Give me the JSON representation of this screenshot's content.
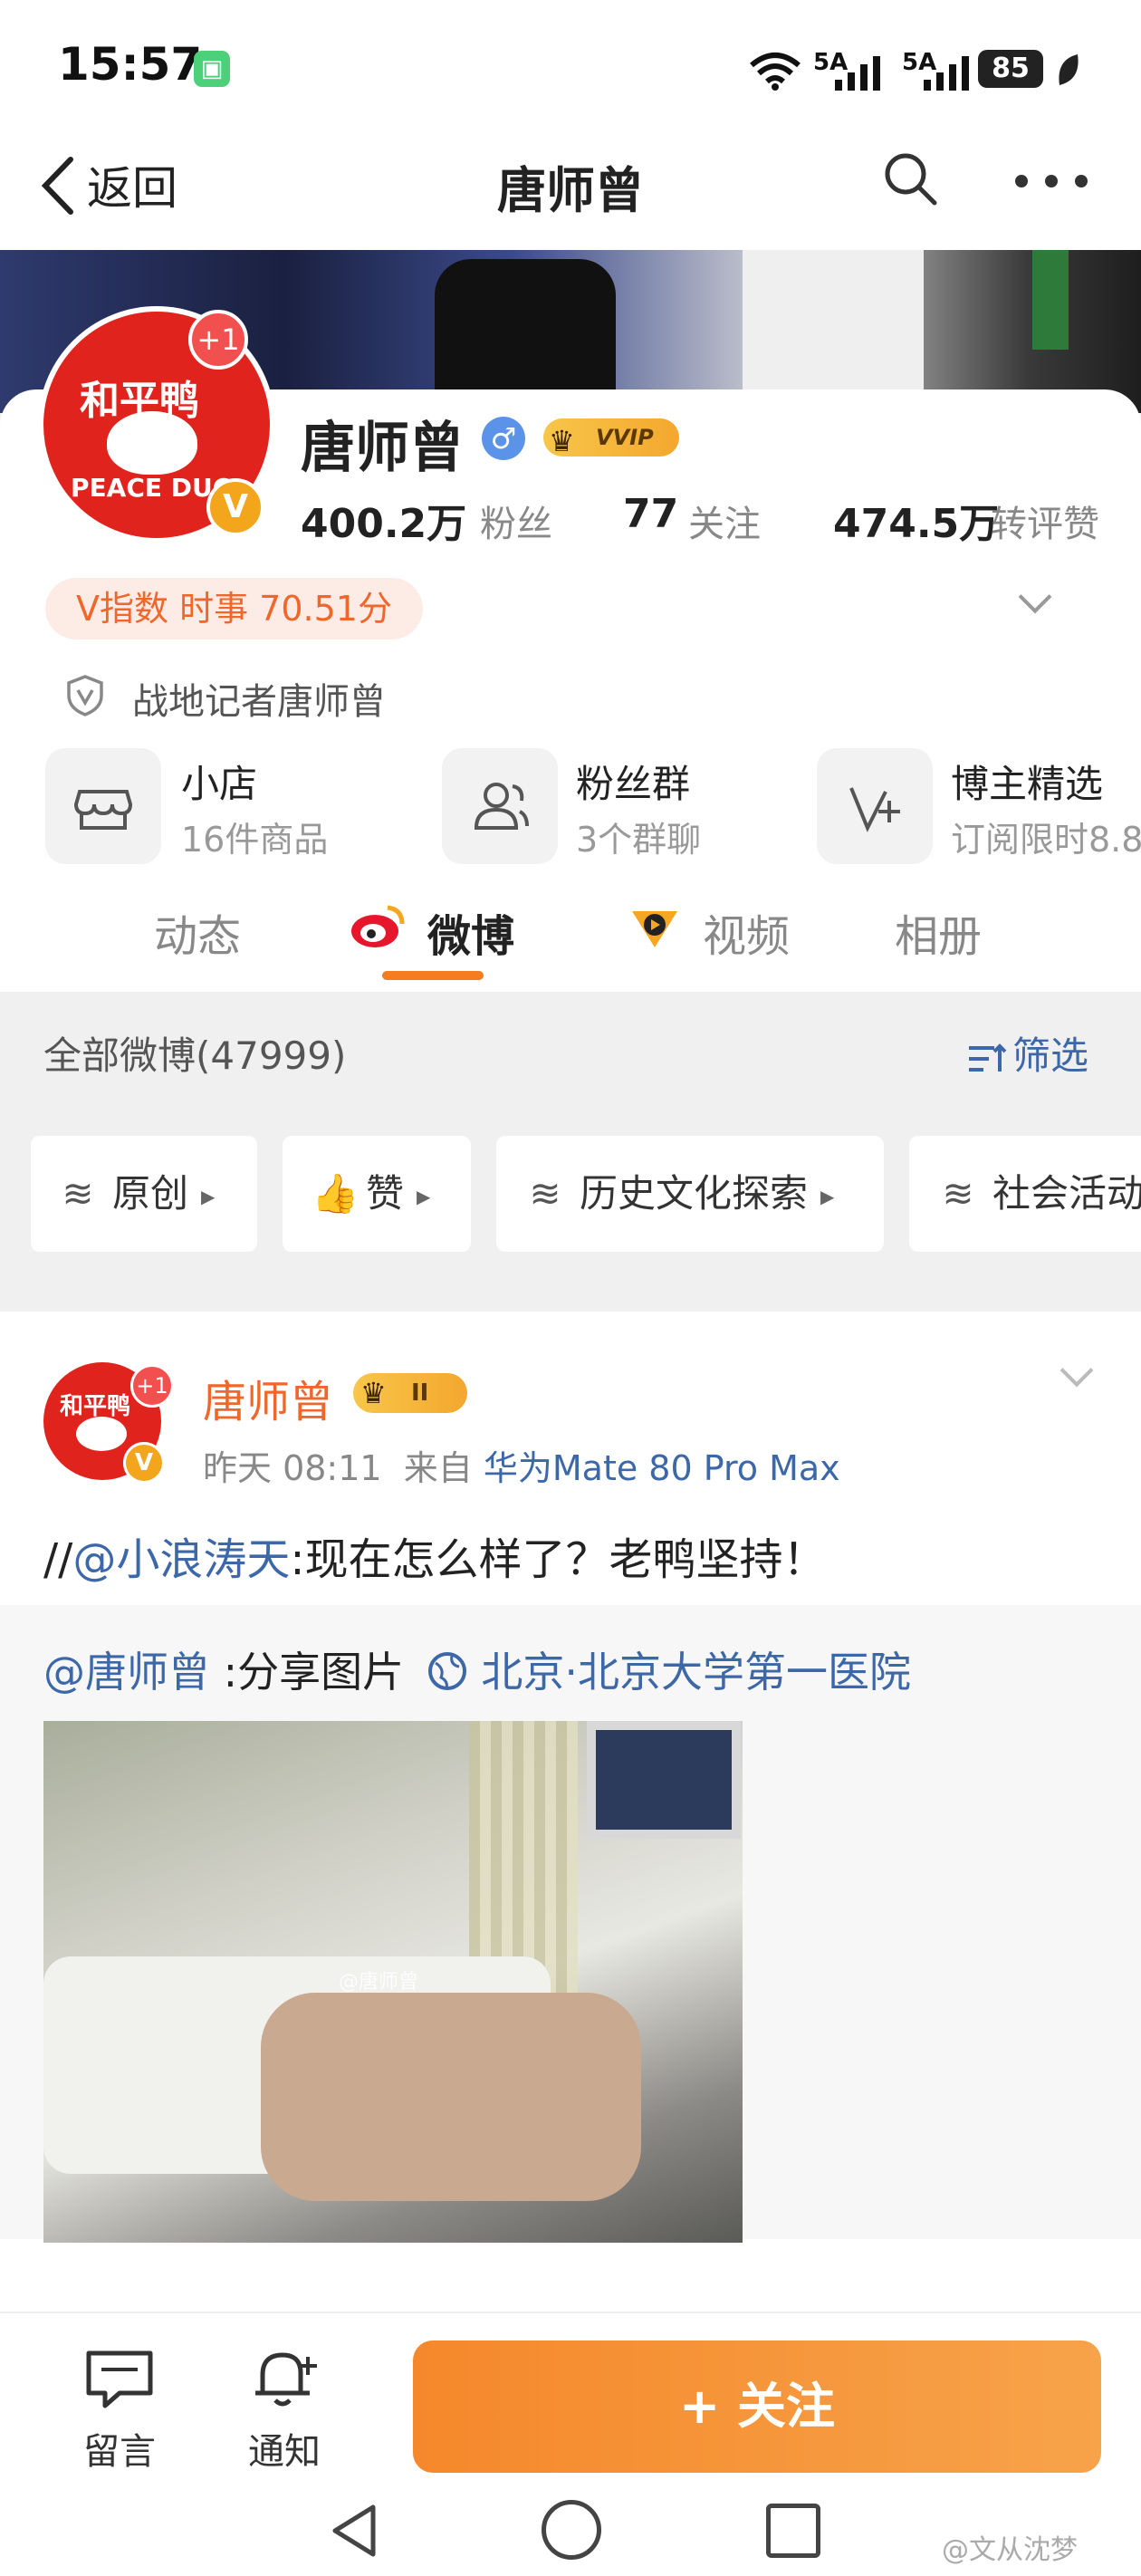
{
  "status_bar": {
    "time": "15:57",
    "signal1": "5A",
    "signal2": "5A",
    "battery": "85"
  },
  "nav": {
    "back_label": "返回",
    "title": "唐师曾"
  },
  "profile": {
    "avatar_text": "和平鸭",
    "avatar_subtext": "PEACE DUC",
    "badge_count": "+1",
    "name": "唐师曾",
    "gender_symbol": "♂",
    "vip_label": "VVIP",
    "followers_count": "400.2万",
    "followers_label": "粉丝",
    "following_count": "77",
    "following_label": "关注",
    "interactions_count": "474.5万",
    "interactions_label": "转评赞",
    "v_index": "V指数 时事 70.51分",
    "certification": "战地记者唐师曾"
  },
  "tools": [
    {
      "title": "小店",
      "sub": "16件商品",
      "icon": "shop-icon"
    },
    {
      "title": "粉丝群",
      "sub": "3个群聊",
      "icon": "group-icon"
    },
    {
      "title": "博主精选",
      "sub": "订阅限时8.8",
      "icon": "star-edit-icon"
    }
  ],
  "tabs": [
    {
      "label": "动态"
    },
    {
      "label": "微博"
    },
    {
      "label": "视频"
    },
    {
      "label": "相册"
    }
  ],
  "feed_header": {
    "all_count": "全部微博(47999)",
    "filter_label": "筛选"
  },
  "chips": [
    {
      "label": "原创"
    },
    {
      "label": "赞"
    },
    {
      "label": "历史文化探索"
    },
    {
      "label": "社会活动"
    }
  ],
  "post": {
    "author": "唐师曾",
    "badge_count": "+1",
    "vip_level": "II",
    "time": "昨天 08:11",
    "from_label": "来自",
    "device": "华为Mate 80 Pro Max",
    "text_prefix": "//",
    "mention": "@小浪涛天",
    "text": ":现在怎么样了？老鸭坚持！",
    "repost_mention": "@唐师曾",
    "repost_text": " :分享图片",
    "location": "北京·北京大学第一医院",
    "photo_watermark": "@唐师曾"
  },
  "bottom_bar": {
    "comment_label": "留言",
    "notify_label": "通知",
    "follow_label": "+ 关注"
  },
  "watermark": "@文从沈梦",
  "colors": {
    "accent": "#f57c1f",
    "link": "#3c67a8",
    "follow_button": "#f5882b"
  }
}
